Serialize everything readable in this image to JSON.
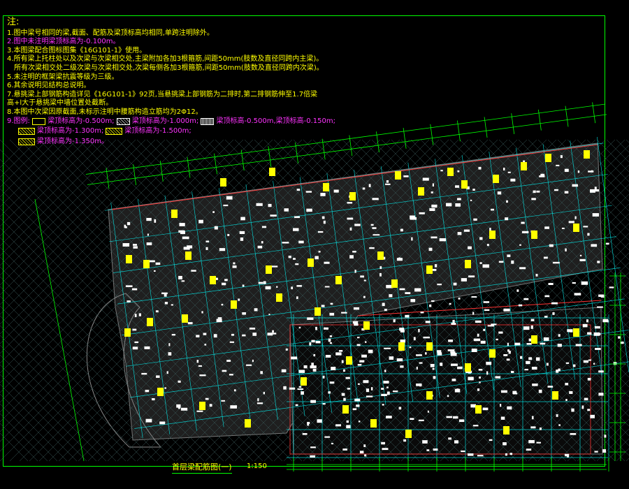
{
  "notes": {
    "header": "注:",
    "items": [
      "1.图中梁号相同的梁,截面、配筋及梁顶标高均相同,单跨注明除外。",
      "2.图中未注明梁顶标高为-0.100m。",
      "3.本图梁配合图标图集《16G101-1》使用。",
      "4.所有梁上托柱处以及次梁与次梁相交处,主梁附加各加3根箍筋,间距50mm(肢数及直径同跨内主梁)。",
      "所有次梁相交处二级次梁与次梁相交处,次梁每侧各加3根箍筋,间距50mm(肢数及直径同跨内次梁)。",
      "5.未注明的框架梁抗震等级为三级。",
      "6.其余说明见结构总说明。",
      "7.悬挑梁上部钢筋构造详见《16G101-1》92页,当悬挑梁上部钢筋为二排时,第二排钢筋伸至1.7倍梁",
      "  高+l大于悬挑梁中墙位置处截断。",
      "8.本图中次梁因原截面,未标示注明中腰筋构造立筋均为2Φ12。"
    ],
    "legend_label": "9.图例:",
    "legend": [
      {
        "label": "梁顶标高为-0.500m;",
        "pattern": "blank"
      },
      {
        "label": "梁顶标高为-1.000m;",
        "pattern": "cross"
      },
      {
        "label": "梁顶标高-0.500m,梁顶标高-0.150m;",
        "pattern": "dense"
      },
      {
        "label": "梁顶标高为-1.300m;",
        "pattern": "hatch"
      },
      {
        "label": "梁顶标高为-1.500m;",
        "pattern": "hatch"
      },
      {
        "label": "梁顶标高为-1.350m。",
        "pattern": "hatch"
      }
    ]
  },
  "drawing": {
    "title": "首层梁配筋图(一)",
    "scale": "1:150",
    "colors": {
      "background": "#000000",
      "frame": "#00ff00",
      "grid": "#00ffff",
      "dimension": "#00ff00",
      "beam": "#ffffff",
      "highlight": "#ffff00",
      "boundary": "#ff3333",
      "note_text": "#ffff00",
      "note_magenta": "#ff33ff"
    }
  }
}
